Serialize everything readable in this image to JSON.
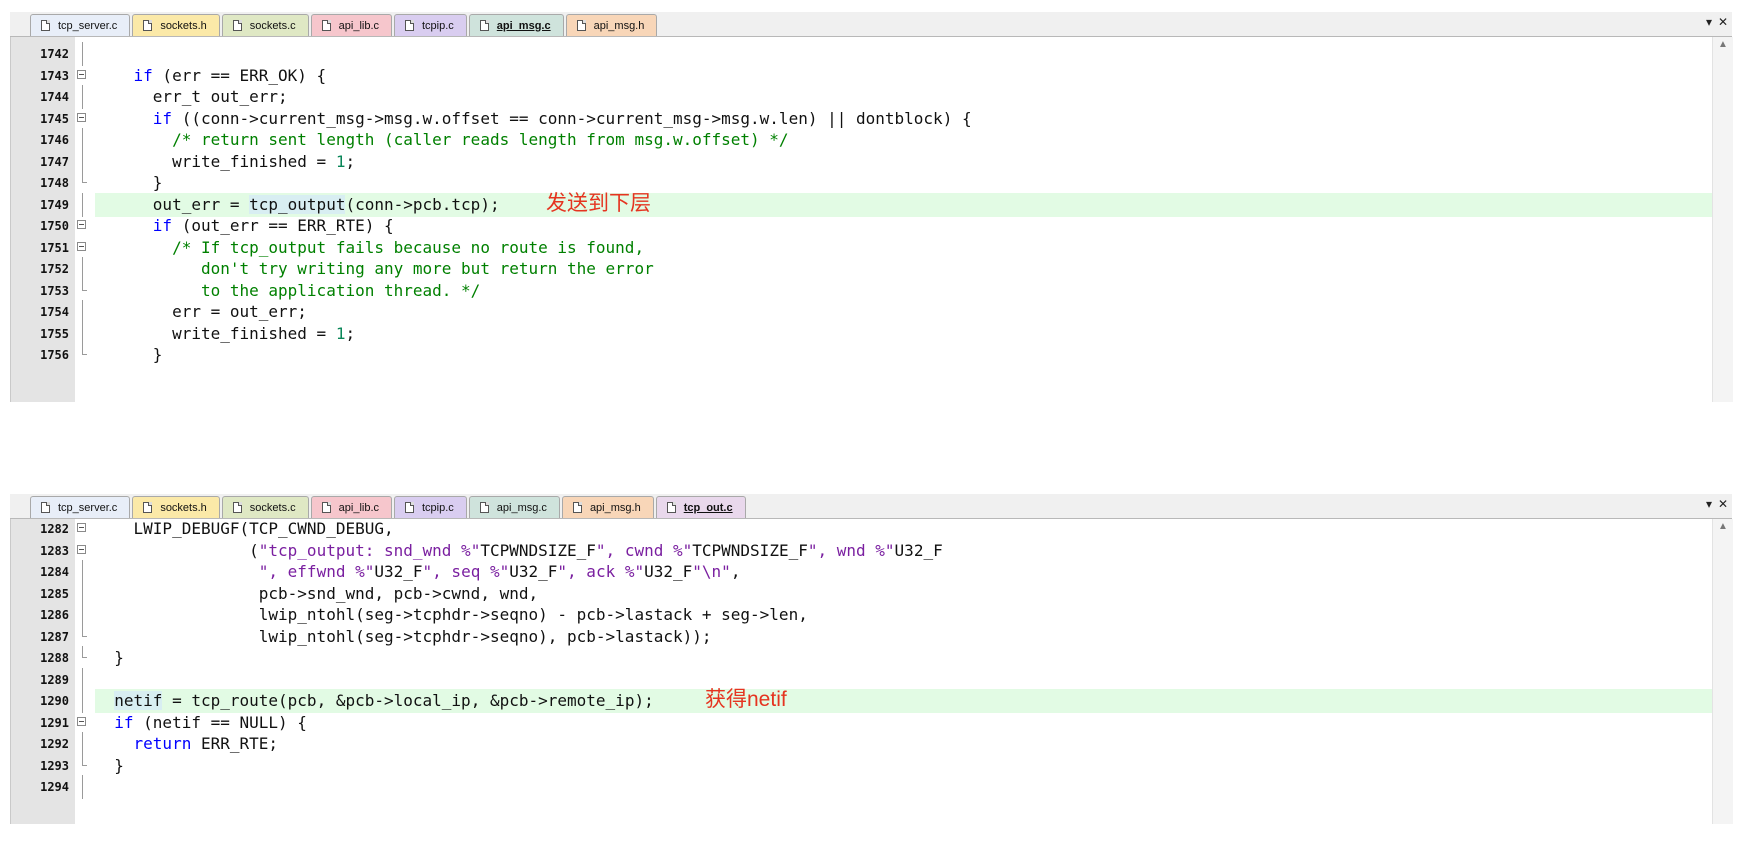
{
  "pane1": {
    "tabs": [
      "tcp_server.c",
      "sockets.h",
      "sockets.c",
      "api_lib.c",
      "tcpip.c",
      "api_msg.c",
      "api_msg.h"
    ],
    "active_tab": "api_msg.c",
    "dropdown_icon": "▾",
    "close_icon": "✕",
    "annotation": "发送到下层",
    "lines": [
      {
        "no": "1742",
        "fold": "bar",
        "code": ""
      },
      {
        "no": "1743",
        "fold": "box",
        "code": "    if (err == ERR_OK) {"
      },
      {
        "no": "1744",
        "fold": "bar",
        "code": "      err_t out_err;"
      },
      {
        "no": "1745",
        "fold": "box",
        "code": "      if ((conn->current_msg->msg.w.offset == conn->current_msg->msg.w.len) || dontblock) {"
      },
      {
        "no": "1746",
        "fold": "bar",
        "code": "        /* return sent length (caller reads length from msg.w.offset) */"
      },
      {
        "no": "1747",
        "fold": "bar",
        "code": "        write_finished = 1;"
      },
      {
        "no": "1748",
        "fold": "end",
        "code": "      }"
      },
      {
        "no": "1749",
        "fold": "bar",
        "code": "      out_err = tcp_output(conn->pcb.tcp);"
      },
      {
        "no": "1750",
        "fold": "box",
        "code": "      if (out_err == ERR_RTE) {"
      },
      {
        "no": "1751",
        "fold": "box",
        "code": "        /* If tcp_output fails because no route is found,"
      },
      {
        "no": "1752",
        "fold": "bar",
        "code": "           don't try writing any more but return the error"
      },
      {
        "no": "1753",
        "fold": "end",
        "code": "           to the application thread. */"
      },
      {
        "no": "1754",
        "fold": "bar",
        "code": "        err = out_err;"
      },
      {
        "no": "1755",
        "fold": "bar",
        "code": "        write_finished = 1;"
      },
      {
        "no": "1756",
        "fold": "end",
        "code": "      }"
      }
    ]
  },
  "pane2": {
    "tabs": [
      "tcp_server.c",
      "sockets.h",
      "sockets.c",
      "api_lib.c",
      "tcpip.c",
      "api_msg.c",
      "api_msg.h",
      "tcp_out.c"
    ],
    "active_tab": "tcp_out.c",
    "dropdown_icon": "▾",
    "close_icon": "✕",
    "annotation": "获得netif",
    "lines": [
      {
        "no": "1282",
        "fold": "box",
        "code": "    LWIP_DEBUGF(TCP_CWND_DEBUG,"
      },
      {
        "no": "1283",
        "fold": "box",
        "code": "                (\"tcp_output: snd_wnd %\"TCPWNDSIZE_F\", cwnd %\"TCPWNDSIZE_F\", wnd %\"U32_F"
      },
      {
        "no": "1284",
        "fold": "bar",
        "code": "                 \", effwnd %\"U32_F\", seq %\"U32_F\", ack %\"U32_F\"\\n\","
      },
      {
        "no": "1285",
        "fold": "bar",
        "code": "                 pcb->snd_wnd, pcb->cwnd, wnd,"
      },
      {
        "no": "1286",
        "fold": "bar",
        "code": "                 lwip_ntohl(seg->tcphdr->seqno) - pcb->lastack + seg->len,"
      },
      {
        "no": "1287",
        "fold": "end",
        "code": "                 lwip_ntohl(seg->tcphdr->seqno), pcb->lastack));"
      },
      {
        "no": "1288",
        "fold": "end",
        "code": "  }"
      },
      {
        "no": "1289",
        "fold": "bar",
        "code": ""
      },
      {
        "no": "1290",
        "fold": "bar",
        "code": "  netif = tcp_route(pcb, &pcb->local_ip, &pcb->remote_ip);"
      },
      {
        "no": "1291",
        "fold": "box",
        "code": "  if (netif == NULL) {"
      },
      {
        "no": "1292",
        "fold": "bar",
        "code": "    return ERR_RTE;"
      },
      {
        "no": "1293",
        "fold": "end",
        "code": "  }"
      },
      {
        "no": "1294",
        "fold": "bar",
        "code": ""
      }
    ]
  },
  "tab_colors": {
    "tcp_server.c": "#e8eef8",
    "sockets.h": "#fbe9a8",
    "sockets.c": "#dfe8c4",
    "api_lib.c": "#f6c6cc",
    "tcpip.c": "#d9cdf0",
    "api_msg.c": "#cfe3dc",
    "api_msg.h": "#f8d6b8",
    "tcp_out.c": "#e9d8ec"
  },
  "colors": {
    "highlight_line": "#e2fbe4",
    "annotation": "#e53420",
    "keyword": "#0000ff",
    "comment": "#008000",
    "string": "#7a1fa0",
    "number": "#098658"
  }
}
